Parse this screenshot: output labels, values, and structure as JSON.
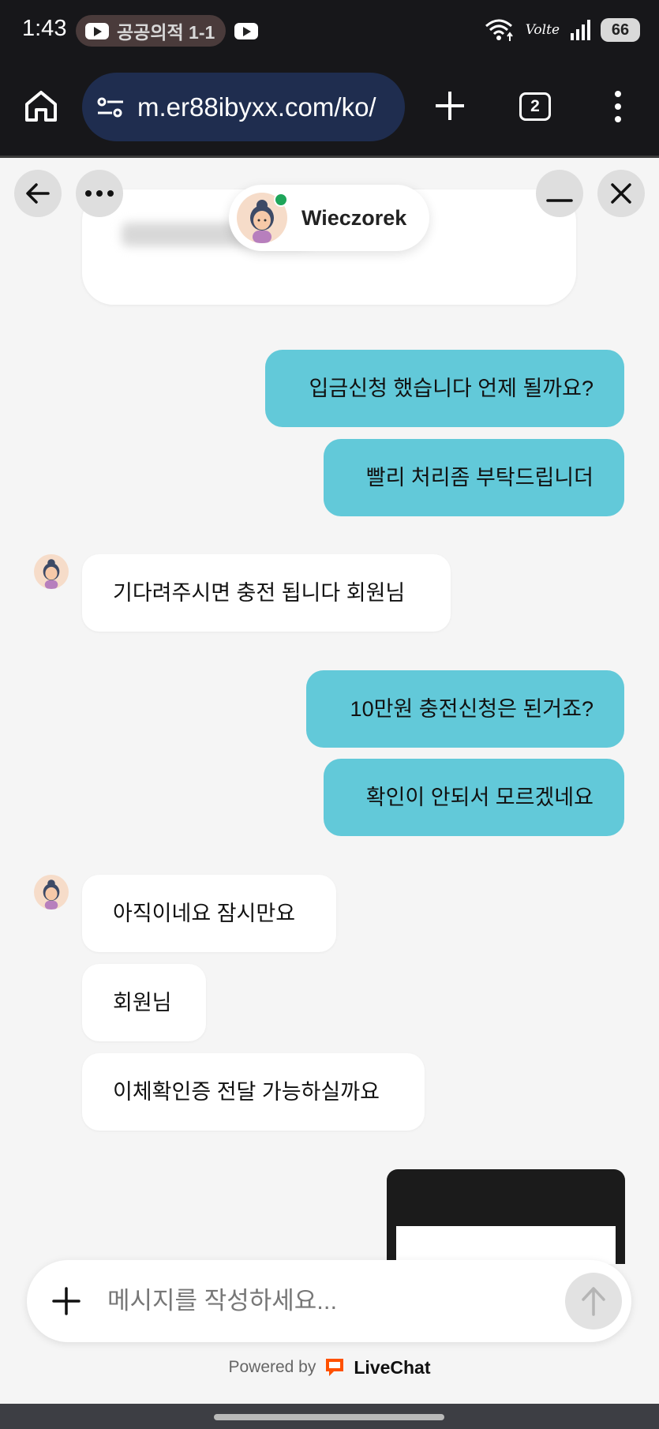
{
  "status_bar": {
    "time": "1:43",
    "notification_text": "공공의적 1-1",
    "network_label": "Volte",
    "battery": "66"
  },
  "browser": {
    "url": "m.er88ibyxx.com/ko/",
    "tab_count": "2"
  },
  "chat_header": {
    "agent_name": "Wieczorek",
    "agent_status_color": "#1ea55a"
  },
  "messages": [
    {
      "from": "me",
      "text": "입금신청 했습니다 언제 될까요?"
    },
    {
      "from": "me",
      "text": "빨리 처리좀 부탁드립니더"
    },
    {
      "from": "agent",
      "text": "기다려주시면 충전 됩니다 회원님"
    },
    {
      "from": "me",
      "text": "10만원 충전신청은 된거죠?"
    },
    {
      "from": "me",
      "text": "확인이 안되서 모르겠네요"
    },
    {
      "from": "agent",
      "text": "아직이네요 잠시만요"
    },
    {
      "from": "agent",
      "text": "회원님"
    },
    {
      "from": "agent",
      "text": "이체확인증 전달 가능하실까요"
    }
  ],
  "composer": {
    "placeholder": "메시지를 작성하세요..."
  },
  "footer": {
    "powered_by": "Powered by",
    "brand": "LiveChat",
    "brand_color": "#ff5100"
  },
  "colors": {
    "my_bubble": "#62c9d9",
    "agent_bubble": "#ffffff",
    "url_bar": "#1f2d4f"
  }
}
